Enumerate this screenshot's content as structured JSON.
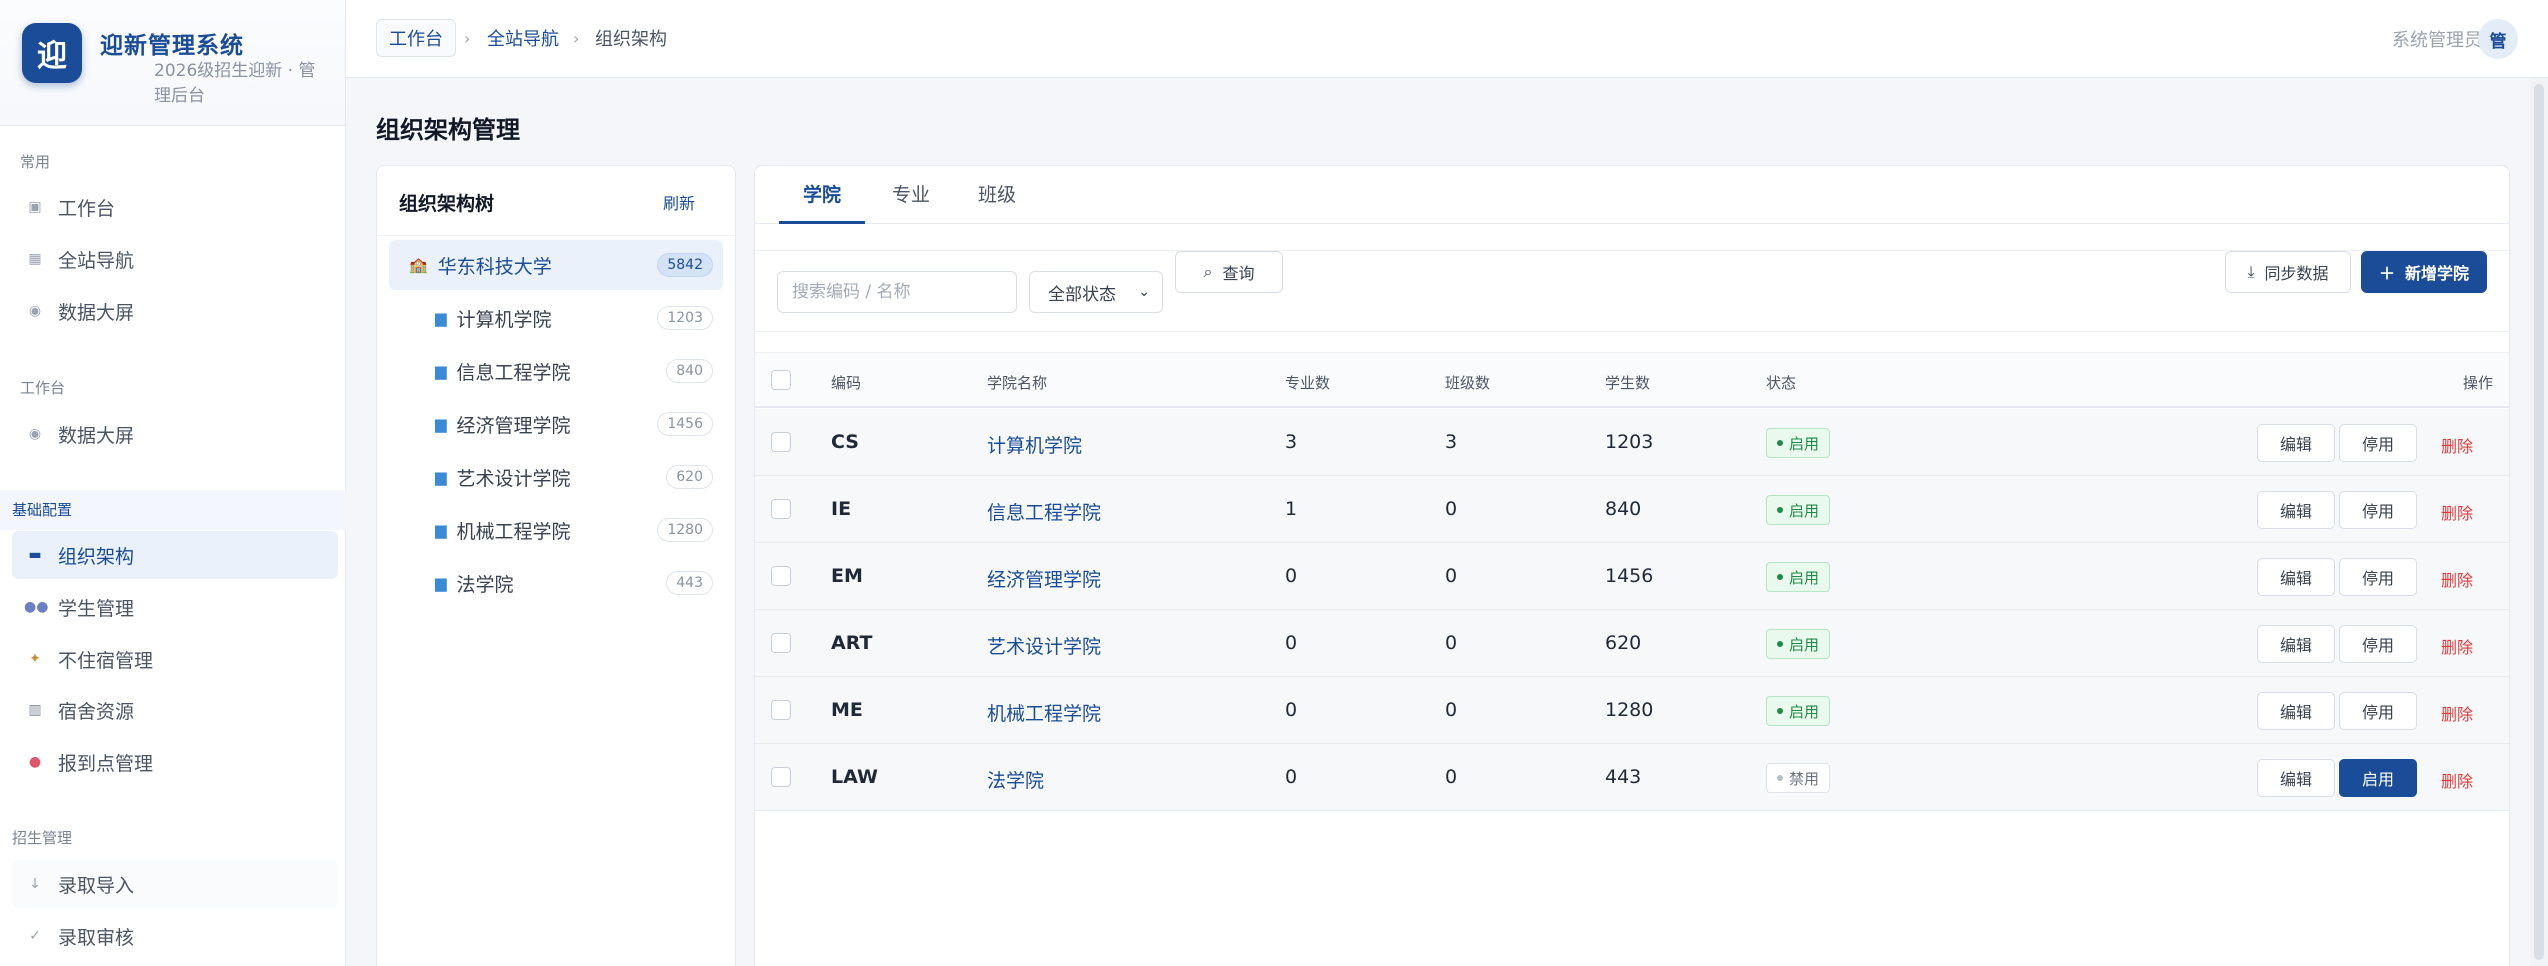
{
  "brand": {
    "logo": "迎",
    "title": "迎新管理系统",
    "subtitle": "2026级招生迎新 · 管理后台"
  },
  "nav": {
    "groups": [
      {
        "title": "常用",
        "items": [
          {
            "label": "工作台",
            "icon": "square-icon"
          },
          {
            "label": "全站导航",
            "icon": "grid-icon"
          },
          {
            "label": "数据大屏",
            "icon": "dot-circle-icon"
          }
        ]
      },
      {
        "title": "工作台",
        "items": [
          {
            "label": "数据大屏",
            "icon": "dot-circle-icon"
          }
        ]
      },
      {
        "title": "基础配置",
        "items": [
          {
            "label": "组织架构",
            "icon": "org-icon",
            "active": true
          },
          {
            "label": "学生管理",
            "icon": "users-icon"
          },
          {
            "label": "不住宿管理",
            "icon": "walker-icon"
          },
          {
            "label": "宿舍资源",
            "icon": "building-icon"
          },
          {
            "label": "报到点管理",
            "icon": "pin-icon"
          }
        ]
      },
      {
        "title": "招生管理",
        "items": [
          {
            "label": "录取导入",
            "icon": "arrow-down-icon"
          },
          {
            "label": "录取审核",
            "icon": "check-icon"
          }
        ]
      }
    ]
  },
  "topbar": {
    "breadcrumb": {
      "home": "工作台",
      "link": "全站导航",
      "current": "组织架构",
      "sep": "›"
    },
    "user": "系统管理员",
    "avatar": "管"
  },
  "page": {
    "title": "组织架构管理"
  },
  "tree": {
    "title": "组织架构树",
    "refresh": "刷新",
    "root": {
      "label": "华东科技大学",
      "count": "5842"
    },
    "children": [
      {
        "label": "计算机学院",
        "count": "1203"
      },
      {
        "label": "信息工程学院",
        "count": "840"
      },
      {
        "label": "经济管理学院",
        "count": "1456"
      },
      {
        "label": "艺术设计学院",
        "count": "620"
      },
      {
        "label": "机械工程学院",
        "count": "1280"
      },
      {
        "label": "法学院",
        "count": "443"
      }
    ]
  },
  "tabs": [
    "学院",
    "专业",
    "班级"
  ],
  "toolbar": {
    "search_placeholder": "搜索编码 / 名称",
    "status_value": "全部状态",
    "query": "查询",
    "sync": "同步数据",
    "add": "新增学院"
  },
  "table": {
    "headers": {
      "code": "编码",
      "name": "学院名称",
      "majors": "专业数",
      "classes": "班级数",
      "students": "学生数",
      "status": "状态",
      "ops": "操作"
    },
    "rows": [
      {
        "code": "CS",
        "name": "计算机学院",
        "majors": "3",
        "classes": "3",
        "students": "1203",
        "status": "启用",
        "enabled": true,
        "edit": "编辑",
        "toggle": "停用",
        "del": "删除"
      },
      {
        "code": "IE",
        "name": "信息工程学院",
        "majors": "1",
        "classes": "0",
        "students": "840",
        "status": "启用",
        "enabled": true,
        "edit": "编辑",
        "toggle": "停用",
        "del": "删除"
      },
      {
        "code": "EM",
        "name": "经济管理学院",
        "majors": "0",
        "classes": "0",
        "students": "1456",
        "status": "启用",
        "enabled": true,
        "edit": "编辑",
        "toggle": "停用",
        "del": "删除"
      },
      {
        "code": "ART",
        "name": "艺术设计学院",
        "majors": "0",
        "classes": "0",
        "students": "620",
        "status": "启用",
        "enabled": true,
        "edit": "编辑",
        "toggle": "停用",
        "del": "删除"
      },
      {
        "code": "ME",
        "name": "机械工程学院",
        "majors": "0",
        "classes": "0",
        "students": "1280",
        "status": "启用",
        "enabled": true,
        "edit": "编辑",
        "toggle": "停用",
        "del": "删除"
      },
      {
        "code": "LAW",
        "name": "法学院",
        "majors": "0",
        "classes": "0",
        "students": "443",
        "status": "禁用",
        "enabled": false,
        "edit": "编辑",
        "toggle": "启用",
        "del": "删除"
      }
    ]
  },
  "colors": {
    "primary": "#1a4c97",
    "success": "#1f8a45",
    "danger": "#dc3b3b"
  }
}
